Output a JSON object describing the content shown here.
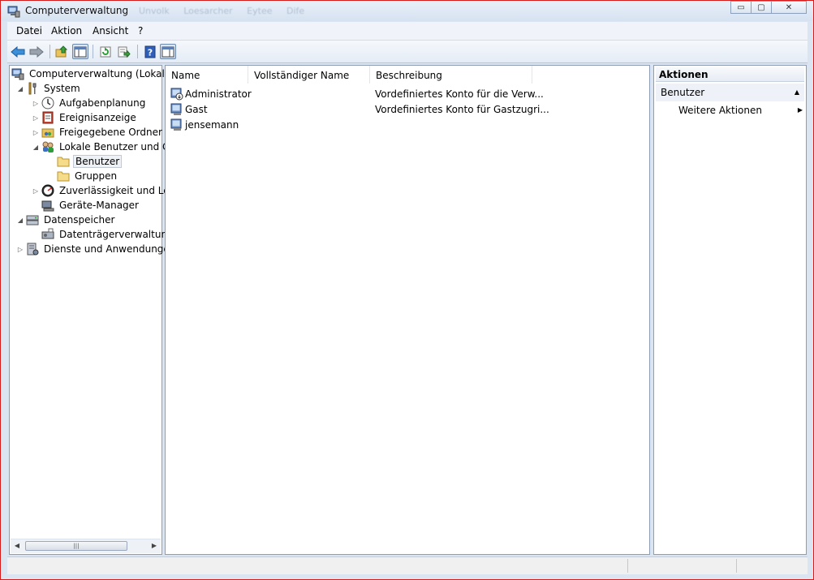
{
  "window": {
    "title": "Computerverwaltung",
    "ghost_menu": [
      "Unvolk",
      "Loesarcher",
      "Eytee",
      "Dife"
    ],
    "controls": {
      "minimize": "▭",
      "maximize": "▢",
      "close": "✕"
    }
  },
  "menubar": {
    "items": [
      "Datei",
      "Aktion",
      "Ansicht",
      "?"
    ]
  },
  "toolbar": {
    "buttons": [
      "back-icon",
      "forward-icon",
      "up-folder-icon",
      "show-hide-tree-icon",
      "refresh-icon",
      "export-list-icon",
      "help-icon",
      "show-hide-action-pane-icon"
    ]
  },
  "tree": {
    "root": "Computerverwaltung (Lokal)",
    "items": [
      "System",
      "Aufgabenplanung",
      "Ereignisanzeige",
      "Freigegebene Ordner",
      "Lokale Benutzer und Gruppen",
      "Benutzer",
      "Gruppen",
      "Zuverlässigkeit und Leistung",
      "Geräte-Manager",
      "Datenspeicher",
      "Datenträgerverwaltung",
      "Dienste und Anwendungen"
    ],
    "selected": "Benutzer",
    "scroll_grip": "|||"
  },
  "list": {
    "columns": [
      "Name",
      "Vollständiger Name",
      "Beschreibung"
    ],
    "rows": [
      {
        "name": "Administrator",
        "full_name": "",
        "description": "Vordefiniertes Konto für die Verw..."
      },
      {
        "name": "Gast",
        "full_name": "",
        "description": "Vordefiniertes Konto für Gastzugri..."
      },
      {
        "name": "jensemann",
        "full_name": "",
        "description": ""
      }
    ]
  },
  "actions": {
    "header": "Aktionen",
    "section": "Benutzer",
    "items": [
      "Weitere Aktionen"
    ]
  },
  "colors": {
    "window_border": "#d41c1c",
    "frame": "#dbe5f1",
    "selection": "#eef1f5"
  }
}
